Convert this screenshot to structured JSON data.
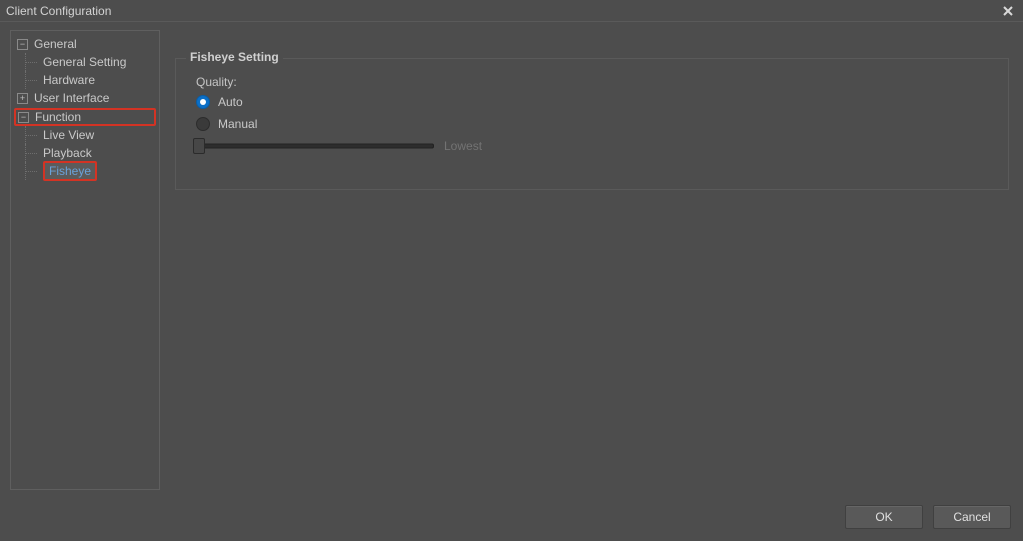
{
  "window": {
    "title": "Client Configuration",
    "close_icon": "close"
  },
  "tree": {
    "general": {
      "label": "General",
      "expanded": true
    },
    "general_setting": {
      "label": "General Setting"
    },
    "hardware": {
      "label": "Hardware"
    },
    "user_interface": {
      "label": "User Interface",
      "expanded": false
    },
    "function": {
      "label": "Function",
      "expanded": true
    },
    "live_view": {
      "label": "Live View"
    },
    "playback": {
      "label": "Playback"
    },
    "fisheye": {
      "label": "Fisheye"
    }
  },
  "panel": {
    "title": "Fisheye Setting",
    "quality_label": "Quality:",
    "radio_auto": "Auto",
    "radio_manual": "Manual",
    "slider_value_label": "Lowest"
  },
  "buttons": {
    "ok": "OK",
    "cancel": "Cancel"
  }
}
